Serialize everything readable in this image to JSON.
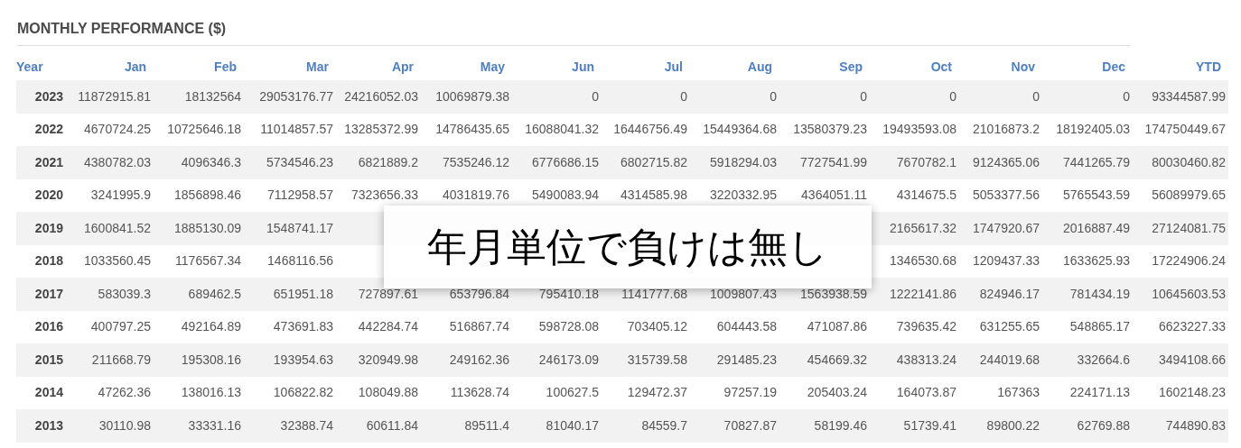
{
  "title": "MONTHLY PERFORMANCE ($)",
  "columns": [
    "Year",
    "Jan",
    "Feb",
    "Mar",
    "Apr",
    "May",
    "Jun",
    "Jul",
    "Aug",
    "Sep",
    "Oct",
    "Nov",
    "Dec",
    "YTD"
  ],
  "rows": [
    [
      "2023",
      "11872915.81",
      "18132564",
      "29053176.77",
      "24216052.03",
      "10069879.38",
      "0",
      "0",
      "0",
      "0",
      "0",
      "0",
      "0",
      "93344587.99"
    ],
    [
      "2022",
      "4670724.25",
      "10725646.18",
      "11014857.57",
      "13285372.99",
      "14786435.65",
      "16088041.32",
      "16446756.49",
      "15449364.68",
      "13580379.23",
      "19493593.08",
      "21016873.2",
      "18192405.03",
      "174750449.67"
    ],
    [
      "2021",
      "4380782.03",
      "4096346.3",
      "5734546.23",
      "6821889.2",
      "7535246.12",
      "6776686.15",
      "6802715.82",
      "5918294.03",
      "7727541.99",
      "7670782.1",
      "9124365.06",
      "7441265.79",
      "80030460.82"
    ],
    [
      "2020",
      "3241995.9",
      "1856898.46",
      "7112958.57",
      "7323656.33",
      "4031819.76",
      "5490083.94",
      "4314585.98",
      "3220332.95",
      "4364051.11",
      "4314675.5",
      "5053377.56",
      "5765543.59",
      "56089979.65"
    ],
    [
      "2019",
      "1600841.52",
      "1885130.09",
      "1548741.17",
      null,
      null,
      null,
      null,
      null,
      null,
      "2165617.32",
      "1747920.67",
      "2016887.49",
      "27124081.75"
    ],
    [
      "2018",
      "1033560.45",
      "1176567.34",
      "1468116.56",
      null,
      null,
      null,
      null,
      null,
      null,
      "1346530.68",
      "1209437.33",
      "1633625.93",
      "17224906.24"
    ],
    [
      "2017",
      "583039.3",
      "689462.5",
      "651951.18",
      "727897.61",
      "653796.84",
      "795410.18",
      "1141777.68",
      "1009807.43",
      "1563938.59",
      "1222141.86",
      "824946.17",
      "781434.19",
      "10645603.53"
    ],
    [
      "2016",
      "400797.25",
      "492164.89",
      "473691.83",
      "442284.74",
      "516867.74",
      "598728.08",
      "703405.12",
      "604443.58",
      "471087.86",
      "739635.42",
      "631255.65",
      "548865.17",
      "6623227.33"
    ],
    [
      "2015",
      "211668.79",
      "195308.16",
      "193954.63",
      "320949.98",
      "249162.36",
      "246173.09",
      "315739.58",
      "291485.23",
      "454669.32",
      "438313.24",
      "244019.68",
      "332664.6",
      "3494108.66"
    ],
    [
      "2014",
      "47262.36",
      "138016.13",
      "106822.82",
      "108049.88",
      "113628.74",
      "100627.5",
      "129472.37",
      "97257.19",
      "205403.24",
      "164073.87",
      "167363",
      "224171.13",
      "1602148.23"
    ],
    [
      "2013",
      "30110.98",
      "33331.16",
      "32388.74",
      "60611.84",
      "89511.4",
      "81040.17",
      "84559.7",
      "70827.87",
      "58199.46",
      "51739.41",
      "89800.22",
      "62769.88",
      "744890.83"
    ]
  ],
  "overlay": {
    "text": "年月単位で負けは無し"
  }
}
